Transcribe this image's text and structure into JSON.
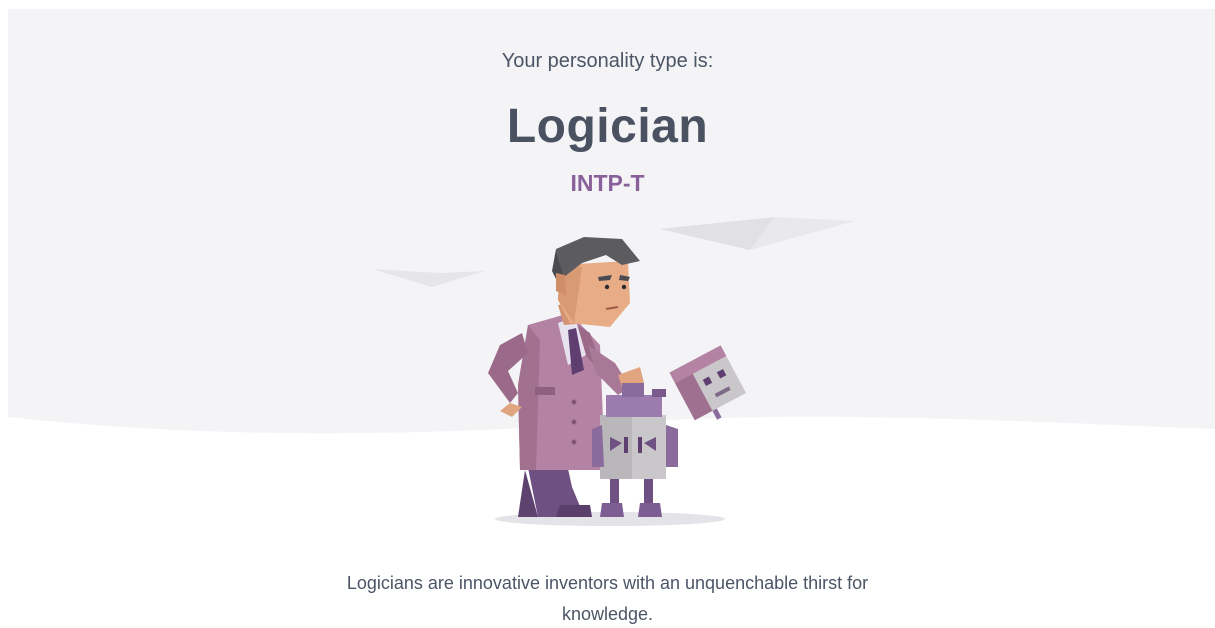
{
  "result": {
    "intro_text": "Your personality type is:",
    "type_name": "Logician",
    "type_code": "INTP-T",
    "description": "Logicians are innovative inventors with an unquenchable thirst for knowledge."
  },
  "illustration": {
    "icon": "logician-character-illustration"
  },
  "colors": {
    "hero_background": "#f4f4f6",
    "title_text": "#4a5262",
    "type_code_accent": "#88619a",
    "body_text": "#4c5566"
  }
}
